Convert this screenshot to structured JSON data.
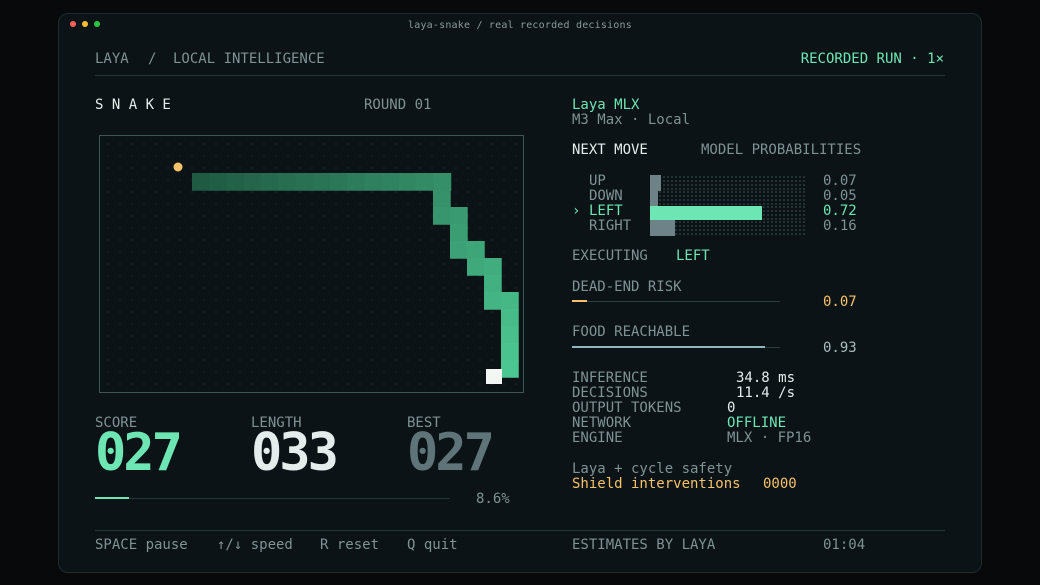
{
  "window": {
    "title": "laya-snake  /  real recorded decisions",
    "traffic_colors": [
      "#ff5f57",
      "#febc2e",
      "#28c840"
    ]
  },
  "header": {
    "brand": "LAYA",
    "sep": "/",
    "section": "LOCAL INTELLIGENCE",
    "status": "RECORDED RUN · 1×"
  },
  "game": {
    "title": "S N A K E",
    "round": "ROUND 01",
    "score_label": "SCORE",
    "score": "027",
    "length_label": "LENGTH",
    "length": "033",
    "best_label": "BEST",
    "best": "027",
    "progress_text": "8.6%",
    "progress_value": 0.086
  },
  "model": {
    "name": "Laya MLX",
    "device": "M3 Max · Local",
    "next_move_label": "NEXT MOVE",
    "probs_label": "MODEL PROBABILITIES",
    "moves": [
      {
        "marker": " ",
        "label": "UP",
        "prob": "0.07",
        "value": 0.07,
        "selected": false
      },
      {
        "marker": " ",
        "label": "DOWN",
        "prob": "0.05",
        "value": 0.05,
        "selected": false
      },
      {
        "marker": "›",
        "label": "LEFT",
        "prob": "0.72",
        "value": 0.72,
        "selected": true
      },
      {
        "marker": " ",
        "label": "RIGHT",
        "prob": "0.16",
        "value": 0.16,
        "selected": false
      }
    ],
    "executing_label": "EXECUTING",
    "executing_value": "LEFT",
    "dead_end_label": "DEAD-END RISK",
    "dead_end_value": "0.07",
    "dead_end_level": 0.07,
    "food_label": "FOOD REACHABLE",
    "food_value": "0.93",
    "food_level": 0.93
  },
  "stats": [
    {
      "label": "INFERENCE",
      "value": "34.8 ms",
      "accent": false
    },
    {
      "label": "DECISIONS",
      "value": "11.4 /s",
      "accent": false
    },
    {
      "label": "OUTPUT TOKENS",
      "value": "0",
      "accent": false
    },
    {
      "label": "NETWORK",
      "value": "OFFLINE",
      "accent": true
    },
    {
      "label": "ENGINE",
      "value": "MLX · FP16",
      "accent": false
    }
  ],
  "safety": {
    "line1": "Laya + cycle safety",
    "line2_label": "Shield interventions",
    "line2_value": "0000"
  },
  "footer": {
    "keys": [
      {
        "key": "SPACE",
        "action": "pause"
      },
      {
        "key": "↑/↓",
        "action": "speed"
      },
      {
        "key": "R",
        "action": "reset"
      },
      {
        "key": "Q",
        "action": "quit"
      }
    ],
    "estimates": "ESTIMATES BY LAYA",
    "time": "01:04"
  },
  "colors": {
    "mint": "#6ee6b4",
    "amber": "#f5c26b",
    "snake_dark": "#1f5a43",
    "snake_light": "#4cc791",
    "head": "#f2f7f4",
    "bar_gray": "#6d8387"
  }
}
